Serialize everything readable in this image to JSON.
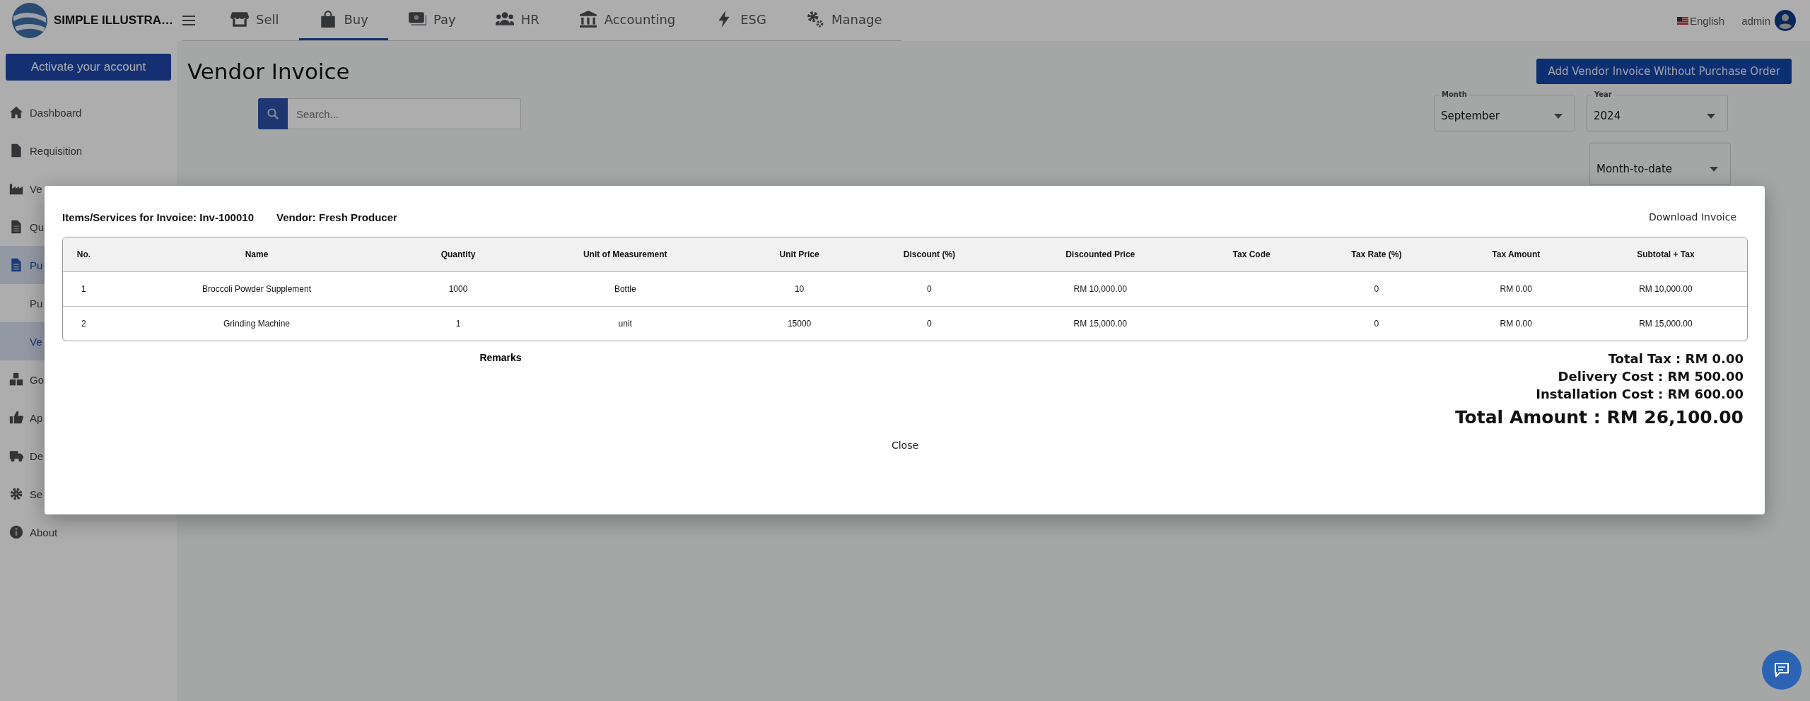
{
  "header": {
    "logo_text": "SIMPLE ILLUSTRA…",
    "language": "English",
    "user": "admin"
  },
  "nav": [
    {
      "label": "Sell",
      "selected": false
    },
    {
      "label": "Buy",
      "selected": true
    },
    {
      "label": "Pay",
      "selected": false
    },
    {
      "label": "HR",
      "selected": false
    },
    {
      "label": "Accounting",
      "selected": false
    },
    {
      "label": "ESG",
      "selected": false
    },
    {
      "label": "Manage",
      "selected": false
    }
  ],
  "sidebar": {
    "activate_button": "Activate your account",
    "items": [
      {
        "label": "Dashboard",
        "kind": "item",
        "selected": false
      },
      {
        "label": "Requisition",
        "kind": "item",
        "selected": false
      },
      {
        "label": "Ve",
        "kind": "item",
        "selected": false
      },
      {
        "label": "Qu",
        "kind": "item",
        "selected": false
      },
      {
        "label": "Pu",
        "kind": "item",
        "selected": true
      },
      {
        "label": "Pu",
        "kind": "subitem",
        "selected": false
      },
      {
        "label": "Ve",
        "kind": "subitem",
        "selected": true
      },
      {
        "label": "Go",
        "kind": "item",
        "selected": false
      },
      {
        "label": "Ap",
        "kind": "item",
        "selected": false
      },
      {
        "label": "De",
        "kind": "item",
        "selected": false
      },
      {
        "label": "Se",
        "kind": "item",
        "selected": false
      },
      {
        "label": "About",
        "kind": "item",
        "selected": false
      }
    ]
  },
  "page": {
    "title": "Vendor Invoice",
    "add_button": "Add Vendor Invoice Without Purchase Order",
    "search": {
      "placeholder": "Search..."
    },
    "filters": [
      {
        "label": "Month",
        "value": "September"
      },
      {
        "label": "Year",
        "value": "2024"
      }
    ],
    "period": {
      "value": "Month-to-date"
    }
  },
  "modal": {
    "title": "Items/Services for Invoice: Inv-100010",
    "vendor": "Vendor: Fresh Producer",
    "download": "Download Invoice",
    "table": {
      "columns": [
        "No.",
        "Name",
        "Quantity",
        "Unit of Measurement",
        "Unit Price",
        "Discount (%)",
        "Discounted Price",
        "Tax Code",
        "Tax Rate (%)",
        "Tax Amount",
        "Subtotal + Tax"
      ],
      "rows": [
        [
          "1",
          "Broccoli Powder Supplement",
          "1000",
          "Bottle",
          "10",
          "0",
          "RM 10,000.00",
          null,
          "0",
          "RM 0.00",
          "RM 10,000.00"
        ],
        [
          "2",
          "Grinding Machine",
          "1",
          "unit",
          "15000",
          "0",
          "RM 15,000.00",
          null,
          "0",
          "RM 0.00",
          "RM 15,000.00"
        ]
      ]
    },
    "remarks": "Remarks",
    "totals": [
      {
        "text": "Total Tax : RM 0.00",
        "kind": "line"
      },
      {
        "text": "Delivery Cost : RM 500.00",
        "kind": "line"
      },
      {
        "text": "Installation Cost : RM 600.00",
        "kind": "line"
      },
      {
        "text": "Total Amount : RM 26,100.00",
        "kind": "grand"
      }
    ],
    "close": "Close"
  }
}
